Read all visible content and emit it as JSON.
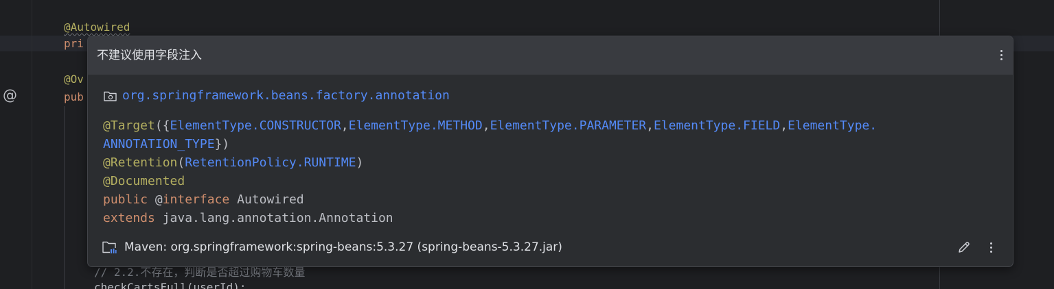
{
  "editor": {
    "line_autowired": "@Autowired",
    "line_pri": "pri",
    "line_ov": "@Ov",
    "line_pub": "pub",
    "comment_line": "// 2.2.不存在，判断是否超过购物车数量",
    "call_line": "checkCartsFull(userId);",
    "gutter_marker": "@"
  },
  "popup": {
    "title": "不建议使用字段注入",
    "package": "org.springframework.beans.factory.annotation",
    "declaration": {
      "target_annotation": "@Target",
      "target_open": "({",
      "element_types": [
        "ElementType.CONSTRUCTOR",
        "ElementType.METHOD",
        "ElementType.PARAMETER",
        "ElementType.FIELD",
        "ElementType."
      ],
      "element_type_wrapped": "ANNOTATION_TYPE",
      "comma": ",",
      "target_close": "})",
      "retention_annotation": "@Retention",
      "retention_open": "(",
      "retention_value": "RetentionPolicy.RUNTIME",
      "retention_close": ")",
      "documented_annotation": "@Documented",
      "kw_public": "public",
      "at_sign": "@",
      "kw_interface": "interface",
      "type_name": "Autowired",
      "kw_extends": "extends",
      "super_type": "java.lang.annotation.Annotation"
    },
    "footer": {
      "library": "Maven: org.springframework:spring-beans:5.3.27 (spring-beans-5.3.27.jar)"
    },
    "icons": {
      "header_more": "more-vertical-icon",
      "package": "package-folder-icon",
      "library": "library-folder-icon",
      "edit": "pencil-icon",
      "footer_more": "more-vertical-icon"
    }
  },
  "colors": {
    "editor_bg": "#1e1f22",
    "popup_bg": "#2b2d30",
    "popup_header_bg": "#393b40",
    "annotation": "#b3ae60",
    "keyword": "#cf8e6d",
    "reference": "#548af7",
    "text": "#bcbec4"
  }
}
